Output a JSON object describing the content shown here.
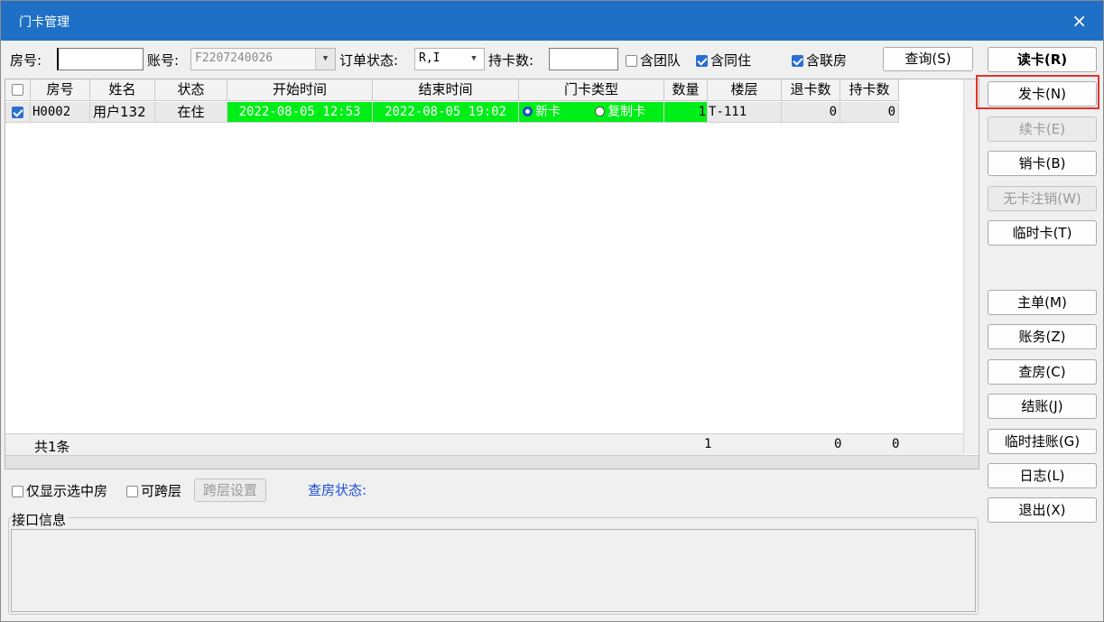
{
  "window": {
    "title": "门卡管理",
    "close_glyph": "×"
  },
  "filter": {
    "room_label": "房号:",
    "room_value": "",
    "account_label": "账号:",
    "account_value": "F2207240026",
    "order_status_label": "订单状态:",
    "order_status_value": "R,I",
    "card_count_label": "持卡数:",
    "card_count_value": "",
    "team_label": "含团队",
    "team_checked": false,
    "cohab_label": "含同住",
    "cohab_checked": true,
    "linked_label": "含联房",
    "linked_checked": true,
    "query_button": "查询(S)"
  },
  "grid": {
    "columns": [
      "房号",
      "姓名",
      "状态",
      "开始时间",
      "结束时间",
      "门卡类型",
      "数量",
      "楼层",
      "退卡数",
      "持卡数"
    ],
    "rows": [
      {
        "checked": true,
        "room": "H0002",
        "name": "用户132",
        "status": "在住",
        "start": "2022-08-05 12:53",
        "end": "2022-08-05 19:02",
        "card_type_options": [
          "新卡",
          "复制卡"
        ],
        "card_type_selected": "新卡",
        "qty": "1",
        "floor": "T-111",
        "returned": "0",
        "held": "0"
      }
    ],
    "footer": {
      "total_label": "共1条",
      "qty_total": "1",
      "returned_total": "0",
      "held_total": "0"
    }
  },
  "sidebar": {
    "read_card": "读卡(R)",
    "issue_card": "发卡(N)",
    "renew_card": "续卡(E)",
    "cancel_card": "销卡(B)",
    "cancel_no_card": "无卡注销(W)",
    "temp_card": "临时卡(T)",
    "master_bill": "主单(M)",
    "accounts": "账务(Z)",
    "check_room": "查房(C)",
    "checkout": "结账(J)",
    "temp_charge": "临时挂账(G)",
    "log": "日志(L)",
    "exit": "退出(X)"
  },
  "bottom": {
    "only_selected_label": "仅显示选中房",
    "cross_floor_label": "可跨层",
    "cross_floor_settings": "跨层设置",
    "check_status_label": "查房状态:",
    "interface_info_label": "接口信息"
  },
  "colors": {
    "titlebar": "#1e6fc6",
    "time_cell": "#00ee18",
    "highlight": "#e0342b",
    "link": "#1a4fd8"
  }
}
